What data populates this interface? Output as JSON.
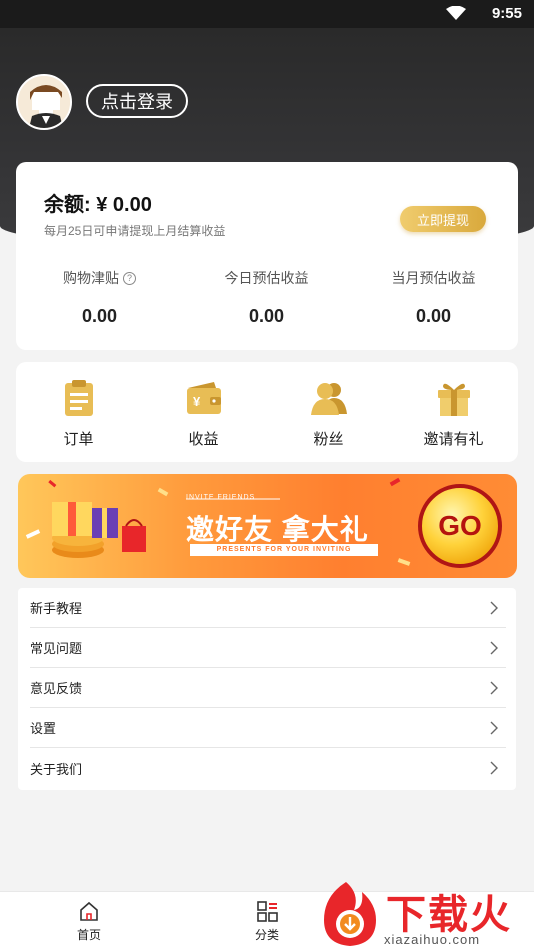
{
  "status_bar": {
    "time": "9:55"
  },
  "profile": {
    "login_label": "点击登录"
  },
  "balance": {
    "title": "余额: ¥ 0.00",
    "note": "每月25日可申请提现上月结算收益",
    "withdraw_label": "立即提现",
    "stats": [
      {
        "label": "购物津贴",
        "value": "0.00"
      },
      {
        "label": "今日预估收益",
        "value": "0.00"
      },
      {
        "label": "当月预估收益",
        "value": "0.00"
      }
    ],
    "help_icon": "?"
  },
  "menu": {
    "items": [
      {
        "label": "订单",
        "icon": "clipboard-icon"
      },
      {
        "label": "收益",
        "icon": "wallet-icon"
      },
      {
        "label": "粉丝",
        "icon": "users-icon"
      },
      {
        "label": "邀请有礼",
        "icon": "gift-icon"
      }
    ]
  },
  "banner": {
    "small_text": "INVITE FRIENDS",
    "title": "邀好友 拿大礼",
    "subtitle": "PRESENTS FOR YOUR INVITING",
    "go_label": "GO"
  },
  "list": {
    "items": [
      {
        "label": "新手教程"
      },
      {
        "label": "常见问题"
      },
      {
        "label": "意见反馈"
      },
      {
        "label": "设置"
      },
      {
        "label": "关于我们"
      }
    ]
  },
  "bottom_nav": {
    "items": [
      {
        "label": "首页",
        "icon": "home-icon"
      },
      {
        "label": "分类",
        "icon": "category-icon"
      }
    ]
  },
  "watermark": {
    "text": "下载火",
    "url": "xiazaihuo.com"
  },
  "colors": {
    "gold": "#d9a93c",
    "header_dark": "#2a2a2a",
    "banner_orange": "#ff7f2f",
    "brand_red": "#e8262a"
  }
}
